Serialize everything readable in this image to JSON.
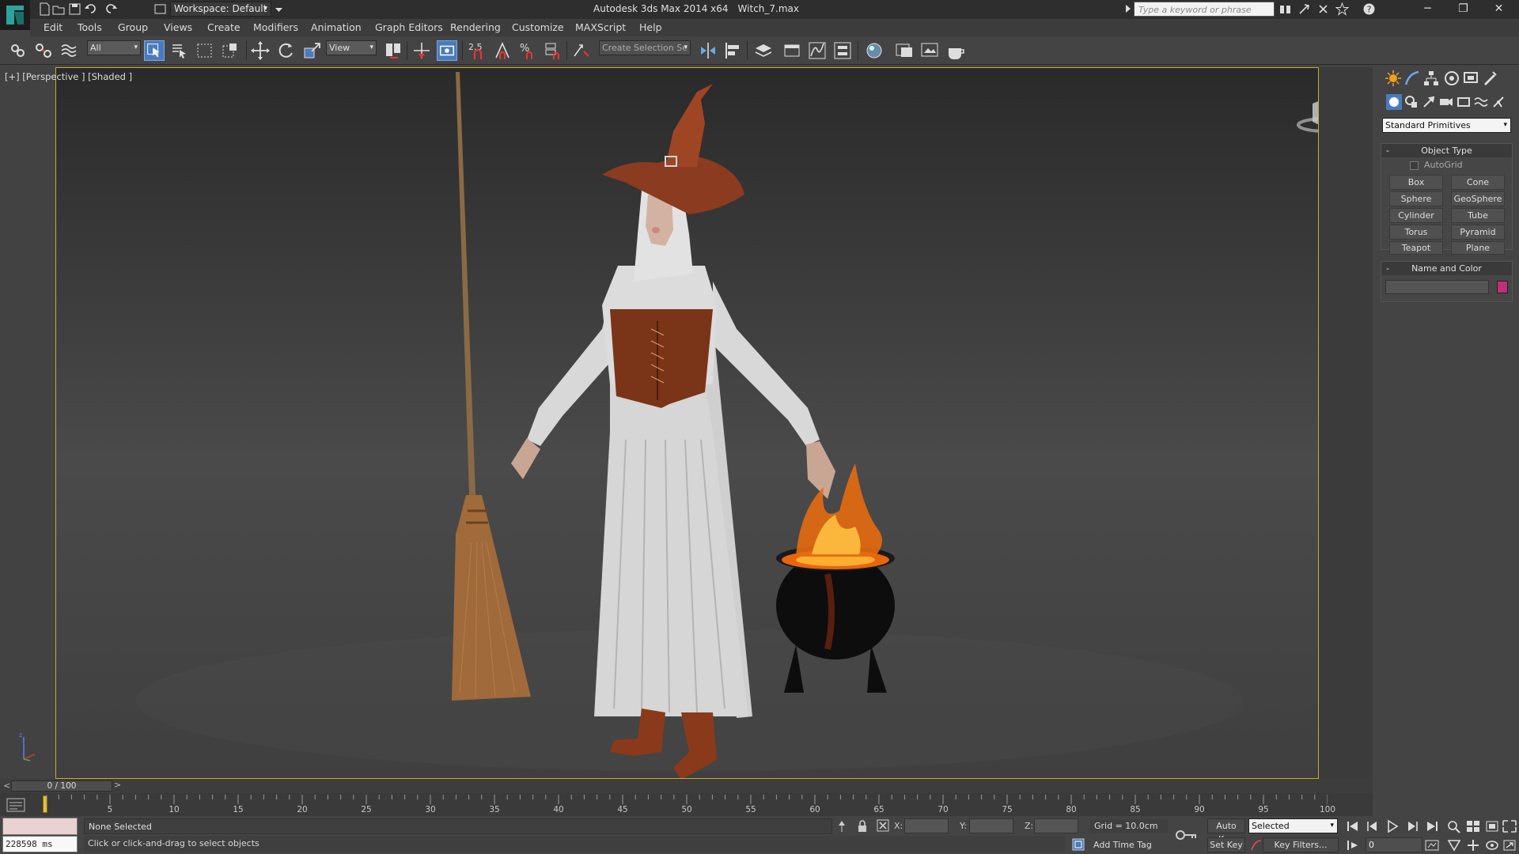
{
  "titlebar": {
    "workspace_label": "Workspace: Default",
    "app_title": "Autodesk 3ds Max  2014 x64",
    "file_name": "Witch_7.max",
    "search_placeholder": "Type a keyword or phrase",
    "minimize": "─",
    "restore": "❐",
    "close": "✕"
  },
  "menu": [
    "Edit",
    "Tools",
    "Group",
    "Views",
    "Create",
    "Modifiers",
    "Animation",
    "Graph Editors",
    "Rendering",
    "Customize",
    "MAXScript",
    "Help"
  ],
  "toolbar": {
    "selection_filter": "All",
    "ref_coord": "View",
    "snap_label": "2.5",
    "named_selection": "Create Selection Se"
  },
  "viewport": {
    "label": "[+] [Perspective ] [Shaded ]"
  },
  "command_panel": {
    "category": "Standard Primitives",
    "object_type_title": "Object Type",
    "autogrid_label": "AutoGrid",
    "primitives": [
      "Box",
      "Cone",
      "Sphere",
      "GeoSphere",
      "Cylinder",
      "Tube",
      "Torus",
      "Pyramid",
      "Teapot",
      "Plane"
    ],
    "name_color_title": "Name and Color",
    "object_color": "#c0307a"
  },
  "timeline": {
    "frame_display": "0 / 100",
    "prev_label": "<",
    "next_label": ">",
    "tick_labels": [
      "5",
      "10",
      "15",
      "20",
      "25",
      "30",
      "35",
      "40",
      "45",
      "50",
      "55",
      "60",
      "65",
      "70",
      "75",
      "80",
      "85",
      "90",
      "95",
      "100"
    ]
  },
  "status": {
    "maxscript_output": "228598 ms",
    "selection": "None Selected",
    "prompt": "Click or click-and-drag to select objects",
    "x_label": "X:",
    "y_label": "Y:",
    "z_label": "Z:",
    "grid": "Grid = 10.0cm",
    "add_time_tag": "Add Time Tag",
    "auto_key": "Auto Key",
    "set_key": "Set Key",
    "key_mode": "Selected",
    "key_filters": "Key Filters...",
    "current_frame": "0"
  },
  "colors": {
    "viewport_border": "#c9a92c",
    "active_tool": "#4a7bbd"
  }
}
